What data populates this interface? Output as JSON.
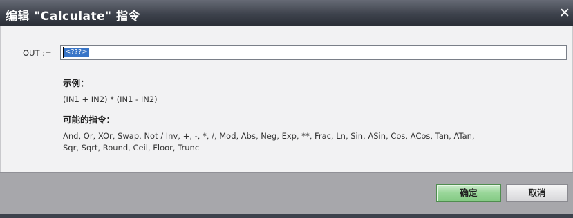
{
  "window": {
    "title": "编辑 \"Calculate\" 指令",
    "close_label": "✕"
  },
  "expression": {
    "label": "OUT :=",
    "value": "<???>"
  },
  "example": {
    "heading": "示例：",
    "text": "(IN1 + IN2) * (IN1 - IN2)"
  },
  "instructions": {
    "heading": "可能的指令：",
    "line1": "And, Or, XOr, Swap, Not / Inv, +, -, *, /, Mod, Abs, Neg, Exp, **, Frac, Ln, Sin, ASin, Cos, ACos, Tan, ATan,",
    "line2": "Sqr, Sqrt, Round, Ceil, Floor, Trunc"
  },
  "buttons": {
    "ok_label": "确定",
    "cancel_label": "取消"
  },
  "colors": {
    "titlebar": "#3d424c",
    "ok_button": "#98d698",
    "selection": "#3975c7",
    "footer": "#a7a7ab"
  }
}
